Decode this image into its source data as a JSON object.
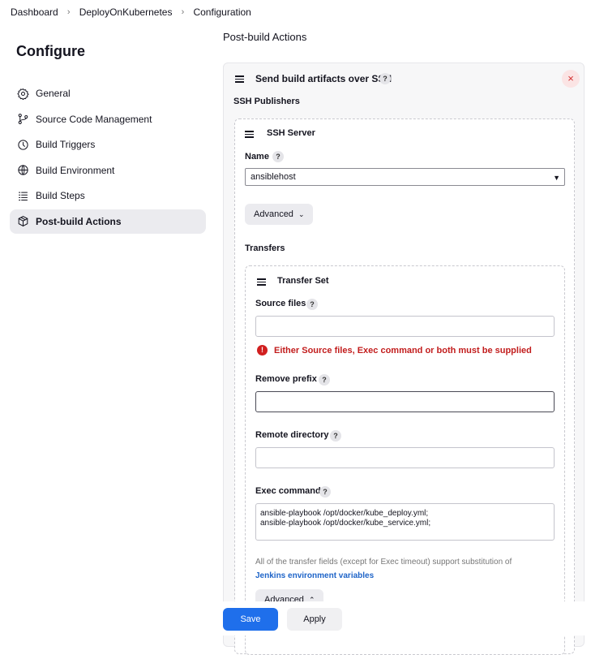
{
  "breadcrumb": {
    "items": [
      "Dashboard",
      "DeployOnKubernetes",
      "Configuration"
    ],
    "separator": "›"
  },
  "sidebar": {
    "title": "Configure",
    "items": [
      {
        "label": "General",
        "icon": "gear-icon"
      },
      {
        "label": "Source Code Management",
        "icon": "git-branch-icon"
      },
      {
        "label": "Build Triggers",
        "icon": "clock-icon"
      },
      {
        "label": "Build Environment",
        "icon": "globe-icon"
      },
      {
        "label": "Build Steps",
        "icon": "list-icon"
      },
      {
        "label": "Post-build Actions",
        "icon": "package-icon",
        "active": true
      }
    ]
  },
  "main": {
    "section_title": "Post-build Actions",
    "publisher": {
      "title": "Send build artifacts over SSH",
      "close_icon": "×",
      "help_icon": "?",
      "ssh_publishers_label": "SSH Publishers",
      "ssh_server": {
        "title": "SSH Server",
        "name_label": "Name",
        "name_value": "ansiblehost",
        "advanced_label": "Advanced"
      },
      "transfers_label": "Transfers",
      "transfer_set": {
        "title": "Transfer Set",
        "source_files_label": "Source files",
        "source_files_value": "",
        "error_text": "Either Source files, Exec command or both must be supplied",
        "error_icon": "!",
        "remove_prefix_label": "Remove prefix",
        "remove_prefix_value": "",
        "remote_directory_label": "Remote directory",
        "remote_directory_value": "",
        "exec_command_label": "Exec command",
        "exec_command_value": "ansible-playbook /opt/docker/kube_deploy.yml;\nansible-playbook /opt/docker/kube_service.yml;",
        "note_text": "All of the transfer fields (except for Exec timeout) support substitution of",
        "note_link": "Jenkins environment variables",
        "advanced_label": "Advanced"
      }
    }
  },
  "footer": {
    "save_label": "Save",
    "apply_label": "Apply"
  },
  "colors": {
    "primary": "#1f6feb",
    "error": "#c21d1d",
    "link": "#1e64c8",
    "active_bg": "#ebebef"
  }
}
